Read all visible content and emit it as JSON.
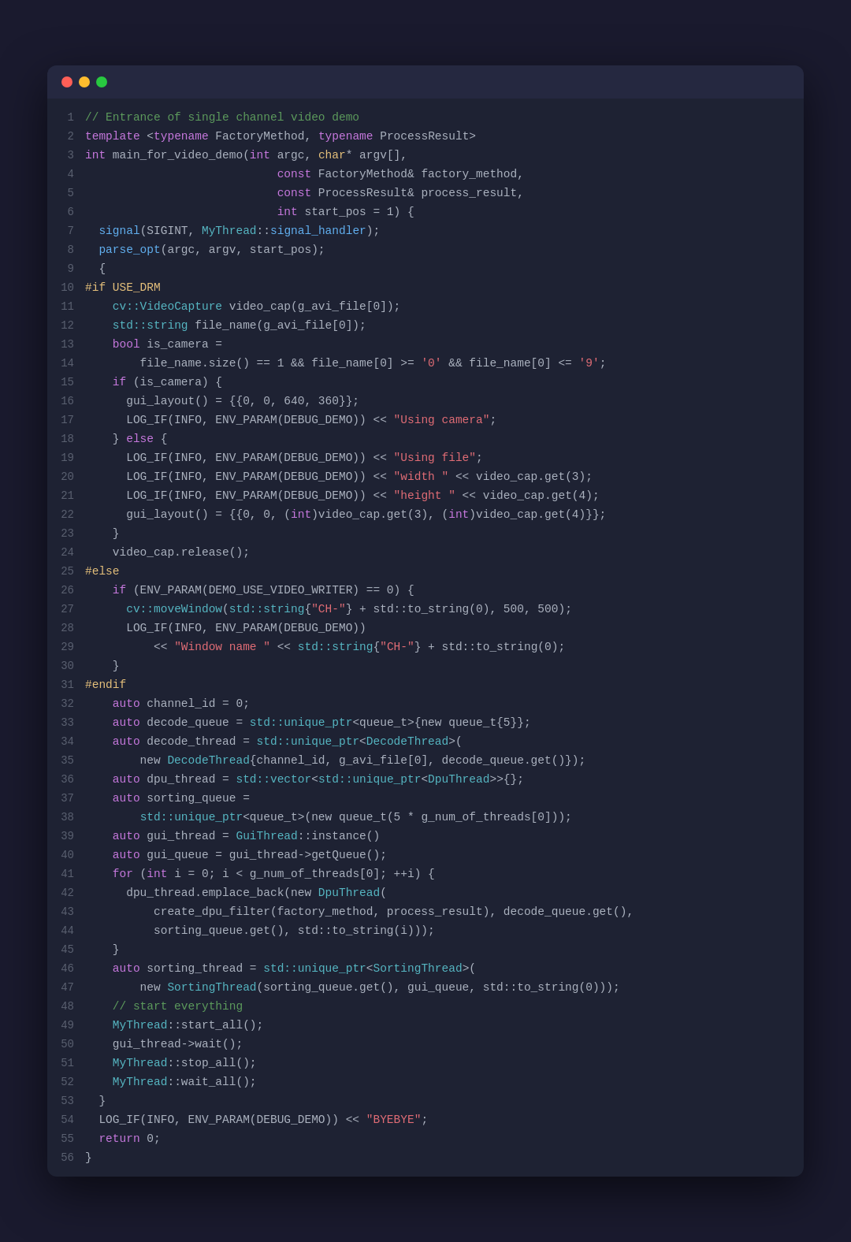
{
  "window": {
    "titlebar": {
      "dot_red": "close",
      "dot_yellow": "minimize",
      "dot_green": "maximize"
    }
  },
  "lines": [
    {
      "num": 1,
      "tokens": [
        {
          "t": "comment",
          "v": "// Entrance of single channel video demo"
        }
      ]
    },
    {
      "num": 2,
      "tokens": [
        {
          "t": "template",
          "v": "template"
        },
        {
          "t": "plain",
          "v": " <"
        },
        {
          "t": "keyword",
          "v": "typename"
        },
        {
          "t": "plain",
          "v": " FactoryMethod, "
        },
        {
          "t": "keyword",
          "v": "typename"
        },
        {
          "t": "plain",
          "v": " ProcessResult>"
        }
      ]
    },
    {
      "num": 3,
      "tokens": [
        {
          "t": "int",
          "v": "int"
        },
        {
          "t": "plain",
          "v": " main_for_video_demo("
        },
        {
          "t": "int",
          "v": "int"
        },
        {
          "t": "plain",
          "v": " argc, "
        },
        {
          "t": "type",
          "v": "char"
        },
        {
          "t": "plain",
          "v": "* argv[],"
        }
      ]
    },
    {
      "num": 4,
      "tokens": [
        {
          "t": "plain",
          "v": "                            "
        },
        {
          "t": "const",
          "v": "const"
        },
        {
          "t": "plain",
          "v": " FactoryMethod"
        },
        {
          "t": "ref",
          "v": "&"
        },
        {
          "t": "plain",
          "v": " factory_method,"
        }
      ]
    },
    {
      "num": 5,
      "tokens": [
        {
          "t": "plain",
          "v": "                            "
        },
        {
          "t": "const",
          "v": "const"
        },
        {
          "t": "plain",
          "v": " ProcessResult"
        },
        {
          "t": "ref",
          "v": "&"
        },
        {
          "t": "plain",
          "v": " process_result,"
        }
      ]
    },
    {
      "num": 6,
      "tokens": [
        {
          "t": "plain",
          "v": "                            "
        },
        {
          "t": "int",
          "v": "int"
        },
        {
          "t": "plain",
          "v": " start_pos = 1) {"
        }
      ]
    },
    {
      "num": 7,
      "tokens": [
        {
          "t": "plain",
          "v": "  "
        },
        {
          "t": "func",
          "v": "signal"
        },
        {
          "t": "plain",
          "v": "(SIGINT, "
        },
        {
          "t": "class",
          "v": "MyThread"
        },
        {
          "t": "plain",
          "v": "::"
        },
        {
          "t": "func",
          "v": "signal_handler"
        },
        {
          "t": "plain",
          "v": ");"
        }
      ]
    },
    {
      "num": 8,
      "tokens": [
        {
          "t": "plain",
          "v": "  "
        },
        {
          "t": "func",
          "v": "parse_opt"
        },
        {
          "t": "plain",
          "v": "(argc, argv, start_pos);"
        }
      ]
    },
    {
      "num": 9,
      "tokens": [
        {
          "t": "plain",
          "v": "  {"
        }
      ]
    },
    {
      "num": 10,
      "tokens": [
        {
          "t": "preproc",
          "v": "#if USE_DRM"
        }
      ]
    },
    {
      "num": 11,
      "tokens": [
        {
          "t": "plain",
          "v": "    "
        },
        {
          "t": "class",
          "v": "cv::VideoCapture"
        },
        {
          "t": "plain",
          "v": " video_cap(g_avi_file[0]);"
        }
      ]
    },
    {
      "num": 12,
      "tokens": [
        {
          "t": "plain",
          "v": "    "
        },
        {
          "t": "class",
          "v": "std::string"
        },
        {
          "t": "plain",
          "v": " file_name(g_avi_file[0]);"
        }
      ]
    },
    {
      "num": 13,
      "tokens": [
        {
          "t": "plain",
          "v": "    "
        },
        {
          "t": "bool",
          "v": "bool"
        },
        {
          "t": "plain",
          "v": " is_camera ="
        }
      ]
    },
    {
      "num": 14,
      "tokens": [
        {
          "t": "plain",
          "v": "        file_name.size() == 1 && file_name[0] >= "
        },
        {
          "t": "string",
          "v": "'0'"
        },
        {
          "t": "plain",
          "v": " && file_name[0] <= "
        },
        {
          "t": "string",
          "v": "'9'"
        },
        {
          "t": "plain",
          "v": ";"
        }
      ]
    },
    {
      "num": 15,
      "tokens": [
        {
          "t": "plain",
          "v": "    "
        },
        {
          "t": "keyword",
          "v": "if"
        },
        {
          "t": "plain",
          "v": " (is_camera) {"
        }
      ]
    },
    {
      "num": 16,
      "tokens": [
        {
          "t": "plain",
          "v": "      gui_layout() = {{0, 0, 640, 360}};"
        }
      ]
    },
    {
      "num": 17,
      "tokens": [
        {
          "t": "plain",
          "v": "      LOG_IF(INFO, ENV_PARAM(DEBUG_DEMO)) << "
        },
        {
          "t": "string",
          "v": "\"Using camera\""
        },
        {
          "t": "plain",
          "v": ";"
        }
      ]
    },
    {
      "num": 18,
      "tokens": [
        {
          "t": "plain",
          "v": "    } "
        },
        {
          "t": "keyword",
          "v": "else"
        },
        {
          "t": "plain",
          "v": " {"
        }
      ]
    },
    {
      "num": 19,
      "tokens": [
        {
          "t": "plain",
          "v": "      LOG_IF(INFO, ENV_PARAM(DEBUG_DEMO)) << "
        },
        {
          "t": "string",
          "v": "\"Using file\""
        },
        {
          "t": "plain",
          "v": ";"
        }
      ]
    },
    {
      "num": 20,
      "tokens": [
        {
          "t": "plain",
          "v": "      LOG_IF(INFO, ENV_PARAM(DEBUG_DEMO)) << "
        },
        {
          "t": "string",
          "v": "\"width \""
        },
        {
          "t": "plain",
          "v": " << video_cap.get(3);"
        }
      ]
    },
    {
      "num": 21,
      "tokens": [
        {
          "t": "plain",
          "v": "      LOG_IF(INFO, ENV_PARAM(DEBUG_DEMO)) << "
        },
        {
          "t": "string",
          "v": "\"height \""
        },
        {
          "t": "plain",
          "v": " << video_cap.get(4);"
        }
      ]
    },
    {
      "num": 22,
      "tokens": [
        {
          "t": "plain",
          "v": "      gui_layout() = {{0, 0, ("
        },
        {
          "t": "int",
          "v": "int"
        },
        {
          "t": "plain",
          "v": ")video_cap.get(3), ("
        },
        {
          "t": "int",
          "v": "int"
        },
        {
          "t": "plain",
          "v": ")video_cap.get(4)}};"
        }
      ]
    },
    {
      "num": 23,
      "tokens": [
        {
          "t": "plain",
          "v": "    }"
        }
      ]
    },
    {
      "num": 24,
      "tokens": [
        {
          "t": "plain",
          "v": "    video_cap.release();"
        }
      ]
    },
    {
      "num": 25,
      "tokens": [
        {
          "t": "preproc",
          "v": "#else"
        }
      ]
    },
    {
      "num": 26,
      "tokens": [
        {
          "t": "plain",
          "v": "    "
        },
        {
          "t": "keyword",
          "v": "if"
        },
        {
          "t": "plain",
          "v": " (ENV_PARAM(DEMO_USE_VIDEO_WRITER) == 0) {"
        }
      ]
    },
    {
      "num": 27,
      "tokens": [
        {
          "t": "plain",
          "v": "      "
        },
        {
          "t": "class",
          "v": "cv::moveWindow"
        },
        {
          "t": "plain",
          "v": "("
        },
        {
          "t": "class",
          "v": "std::string"
        },
        {
          "t": "plain",
          "v": {}
        }
      ]
    },
    {
      "num": 28,
      "tokens": [
        {
          "t": "plain",
          "v": "      LOG_IF(INFO, ENV_PARAM(DEBUG_DEMO))"
        }
      ]
    },
    {
      "num": 29,
      "tokens": [
        {
          "t": "plain",
          "v": "          << "
        },
        {
          "t": "string",
          "v": "\"Window name \""
        },
        {
          "t": "plain",
          "v": " << "
        },
        {
          "t": "class",
          "v": "std::string"
        },
        {
          "t": "plain",
          "v": "{\"CH-\"} + std::to_string(0);"
        }
      ]
    },
    {
      "num": 30,
      "tokens": [
        {
          "t": "plain",
          "v": "    }"
        }
      ]
    },
    {
      "num": 31,
      "tokens": [
        {
          "t": "preproc",
          "v": "#endif"
        }
      ]
    },
    {
      "num": 32,
      "tokens": [
        {
          "t": "plain",
          "v": "    "
        },
        {
          "t": "auto",
          "v": "auto"
        },
        {
          "t": "plain",
          "v": " channel_id = 0;"
        }
      ]
    },
    {
      "num": 33,
      "tokens": [
        {
          "t": "plain",
          "v": "    "
        },
        {
          "t": "auto",
          "v": "auto"
        },
        {
          "t": "plain",
          "v": " decode_queue = "
        },
        {
          "t": "class",
          "v": "std::unique_ptr"
        },
        {
          "t": "plain",
          "v": "<queue_t>{new queue_t{5}};"
        }
      ]
    },
    {
      "num": 34,
      "tokens": [
        {
          "t": "plain",
          "v": "    "
        },
        {
          "t": "auto",
          "v": "auto"
        },
        {
          "t": "plain",
          "v": " decode_thread = "
        },
        {
          "t": "class",
          "v": "std::unique_ptr"
        },
        {
          "t": "plain",
          "v": "<"
        },
        {
          "t": "class",
          "v": "DecodeThread"
        },
        {
          "t": "plain",
          "v": ">("
        }
      ]
    },
    {
      "num": 35,
      "tokens": [
        {
          "t": "plain",
          "v": "        new "
        },
        {
          "t": "class",
          "v": "DecodeThread"
        },
        {
          "t": "plain",
          "v": "{channel_id, g_avi_file[0], decode_queue.get()});"
        }
      ]
    },
    {
      "num": 36,
      "tokens": [
        {
          "t": "plain",
          "v": "    "
        },
        {
          "t": "auto",
          "v": "auto"
        },
        {
          "t": "plain",
          "v": " dpu_thread = "
        },
        {
          "t": "class",
          "v": "std::vector"
        },
        {
          "t": "plain",
          "v": "<"
        },
        {
          "t": "class",
          "v": "std::unique_ptr"
        },
        {
          "t": "plain",
          "v": "<"
        },
        {
          "t": "class",
          "v": "DpuThread"
        },
        {
          "t": "plain",
          "v": ">>{};"
        }
      ]
    },
    {
      "num": 37,
      "tokens": [
        {
          "t": "plain",
          "v": "    "
        },
        {
          "t": "auto",
          "v": "auto"
        },
        {
          "t": "plain",
          "v": " sorting_queue ="
        }
      ]
    },
    {
      "num": 38,
      "tokens": [
        {
          "t": "plain",
          "v": "        "
        },
        {
          "t": "class",
          "v": "std::unique_ptr"
        },
        {
          "t": "plain",
          "v": "<queue_t>(new queue_t(5 * g_num_of_threads[0]));"
        }
      ]
    },
    {
      "num": 39,
      "tokens": [
        {
          "t": "plain",
          "v": "    "
        },
        {
          "t": "auto",
          "v": "auto"
        },
        {
          "t": "plain",
          "v": " gui_thread = "
        },
        {
          "t": "class",
          "v": "GuiThread"
        },
        {
          "t": "plain",
          "v": "::instance()"
        }
      ]
    },
    {
      "num": 40,
      "tokens": [
        {
          "t": "plain",
          "v": "    "
        },
        {
          "t": "auto",
          "v": "auto"
        },
        {
          "t": "plain",
          "v": " gui_queue = gui_thread->getQueue();"
        }
      ]
    },
    {
      "num": 41,
      "tokens": [
        {
          "t": "plain",
          "v": "    "
        },
        {
          "t": "keyword",
          "v": "for"
        },
        {
          "t": "plain",
          "v": " ("
        },
        {
          "t": "int",
          "v": "int"
        },
        {
          "t": "plain",
          "v": " i = 0; i < g_num_of_threads[0]; ++i) {"
        }
      ]
    },
    {
      "num": 42,
      "tokens": [
        {
          "t": "plain",
          "v": "      dpu_thread.emplace_back(new "
        },
        {
          "t": "class",
          "v": "DpuThread"
        },
        {
          "t": "plain",
          "v": "("
        }
      ]
    },
    {
      "num": 43,
      "tokens": [
        {
          "t": "plain",
          "v": "          create_dpu_filter(factory_method, process_result), decode_queue.get(),"
        }
      ]
    },
    {
      "num": 44,
      "tokens": [
        {
          "t": "plain",
          "v": "          sorting_queue.get(), std::to_string(i)));"
        }
      ]
    },
    {
      "num": 45,
      "tokens": [
        {
          "t": "plain",
          "v": "    }"
        }
      ]
    },
    {
      "num": 46,
      "tokens": [
        {
          "t": "plain",
          "v": "    "
        },
        {
          "t": "auto",
          "v": "auto"
        },
        {
          "t": "plain",
          "v": " sorting_thread = "
        },
        {
          "t": "class",
          "v": "std::unique_ptr"
        },
        {
          "t": "plain",
          "v": "<"
        },
        {
          "t": "class",
          "v": "SortingThread"
        },
        {
          "t": "plain",
          "v": ">("
        }
      ]
    },
    {
      "num": 47,
      "tokens": [
        {
          "t": "plain",
          "v": "        new "
        },
        {
          "t": "class",
          "v": "SortingThread"
        },
        {
          "t": "plain",
          "v": "(sorting_queue.get(), gui_queue, std::to_string(0)));"
        }
      ]
    },
    {
      "num": 48,
      "tokens": [
        {
          "t": "comment",
          "v": "    // start everything"
        }
      ]
    },
    {
      "num": 49,
      "tokens": [
        {
          "t": "plain",
          "v": "    "
        },
        {
          "t": "class",
          "v": "MyThread"
        },
        {
          "t": "plain",
          "v": "::start_all();"
        }
      ]
    },
    {
      "num": 50,
      "tokens": [
        {
          "t": "plain",
          "v": "    gui_thread->wait();"
        }
      ]
    },
    {
      "num": 51,
      "tokens": [
        {
          "t": "plain",
          "v": "    "
        },
        {
          "t": "class",
          "v": "MyThread"
        },
        {
          "t": "plain",
          "v": "::stop_all();"
        }
      ]
    },
    {
      "num": 52,
      "tokens": [
        {
          "t": "plain",
          "v": "    "
        },
        {
          "t": "class",
          "v": "MyThread"
        },
        {
          "t": "plain",
          "v": "::wait_all();"
        }
      ]
    },
    {
      "num": 53,
      "tokens": [
        {
          "t": "plain",
          "v": "  }"
        }
      ]
    },
    {
      "num": 54,
      "tokens": [
        {
          "t": "plain",
          "v": "  LOG_IF(INFO, ENV_PARAM(DEBUG_DEMO)) << "
        },
        {
          "t": "string",
          "v": "\"BYEBYE\""
        },
        {
          "t": "plain",
          "v": ";"
        }
      ]
    },
    {
      "num": 55,
      "tokens": [
        {
          "t": "plain",
          "v": "  "
        },
        {
          "t": "keyword",
          "v": "return"
        },
        {
          "t": "plain",
          "v": " 0;"
        }
      ]
    },
    {
      "num": 56,
      "tokens": [
        {
          "t": "plain",
          "v": "}"
        }
      ]
    }
  ]
}
